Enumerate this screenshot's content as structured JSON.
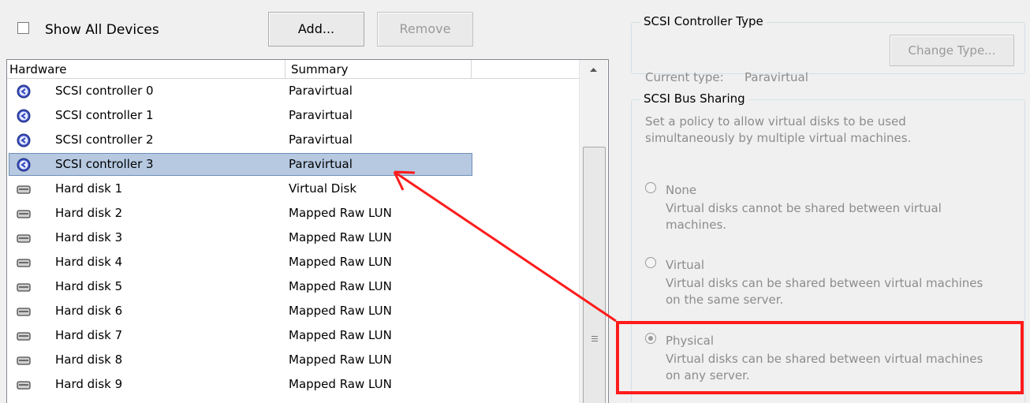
{
  "toolbar": {
    "show_all_devices_label": "Show All Devices",
    "show_all_devices_checked": false,
    "add_label": "Add...",
    "remove_label": "Remove"
  },
  "device_list": {
    "columns": [
      "Hardware",
      "Summary"
    ],
    "rows": [
      {
        "hardware": "SCSI controller 0",
        "summary": "Paravirtual",
        "icon": "scsi-controller-icon",
        "selected": false
      },
      {
        "hardware": "SCSI controller 1",
        "summary": "Paravirtual",
        "icon": "scsi-controller-icon",
        "selected": false
      },
      {
        "hardware": "SCSI controller 2",
        "summary": "Paravirtual",
        "icon": "scsi-controller-icon",
        "selected": false
      },
      {
        "hardware": "SCSI controller 3",
        "summary": "Paravirtual",
        "icon": "scsi-controller-icon",
        "selected": true
      },
      {
        "hardware": "Hard disk 1",
        "summary": "Virtual Disk",
        "icon": "hard-disk-icon",
        "selected": false
      },
      {
        "hardware": "Hard disk 2",
        "summary": "Mapped Raw LUN",
        "icon": "hard-disk-icon",
        "selected": false
      },
      {
        "hardware": "Hard disk 3",
        "summary": "Mapped Raw LUN",
        "icon": "hard-disk-icon",
        "selected": false
      },
      {
        "hardware": "Hard disk 4",
        "summary": "Mapped Raw LUN",
        "icon": "hard-disk-icon",
        "selected": false
      },
      {
        "hardware": "Hard disk 5",
        "summary": "Mapped Raw LUN",
        "icon": "hard-disk-icon",
        "selected": false
      },
      {
        "hardware": "Hard disk 6",
        "summary": "Mapped Raw LUN",
        "icon": "hard-disk-icon",
        "selected": false
      },
      {
        "hardware": "Hard disk 7",
        "summary": "Mapped Raw LUN",
        "icon": "hard-disk-icon",
        "selected": false
      },
      {
        "hardware": "Hard disk 8",
        "summary": "Mapped Raw LUN",
        "icon": "hard-disk-icon",
        "selected": false
      },
      {
        "hardware": "Hard disk 9",
        "summary": "Mapped Raw LUN",
        "icon": "hard-disk-icon",
        "selected": false
      }
    ]
  },
  "controller_type": {
    "title": "SCSI Controller Type",
    "current_type_label": "Current type:",
    "current_type_value": "Paravirtual",
    "change_type_label": "Change Type..."
  },
  "bus_sharing": {
    "title": "SCSI Bus Sharing",
    "description_line1": "Set a policy to allow virtual disks to be used",
    "description_line2": "simultaneously by multiple virtual machines.",
    "options": [
      {
        "label": "None",
        "line1": "Virtual disks cannot be shared between virtual",
        "line2": "machines.",
        "checked": false
      },
      {
        "label": "Virtual",
        "line1": "Virtual disks can be shared between virtual machines",
        "line2": "on the same server.",
        "checked": false
      },
      {
        "label": "Physical",
        "line1": "Virtual disks can be shared between virtual machines",
        "line2": "on any server.",
        "checked": true
      }
    ]
  },
  "colors": {
    "annotation": "#ff1b1b",
    "selection": "#b6c9e1",
    "disabled_text": "#8c8c8c"
  }
}
